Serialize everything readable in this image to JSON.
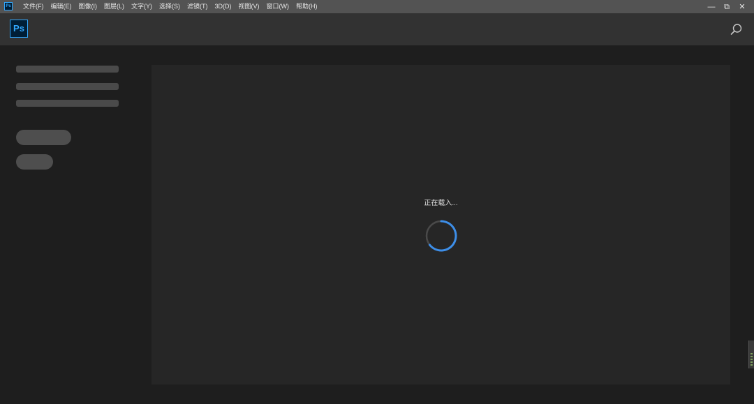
{
  "menubar": {
    "app_icon_label": "Ps",
    "items": [
      {
        "label": "文件(F)"
      },
      {
        "label": "编辑(E)"
      },
      {
        "label": "图像(I)"
      },
      {
        "label": "图层(L)"
      },
      {
        "label": "文字(Y)"
      },
      {
        "label": "选择(S)"
      },
      {
        "label": "滤镜(T)"
      },
      {
        "label": "3D(D)"
      },
      {
        "label": "视图(V)"
      },
      {
        "label": "窗口(W)"
      },
      {
        "label": "帮助(H)"
      }
    ],
    "window_controls": {
      "minimize": "—",
      "restore": "⧉",
      "close": "✕"
    }
  },
  "header": {
    "logo_text": "Ps",
    "search_icon": "search-icon"
  },
  "main": {
    "loading_text": "正在载入...",
    "spinner_color": "#3d8ee8",
    "spinner_track_color": "#4a4a4a"
  },
  "colors": {
    "menubar_bg": "#535353",
    "header_bg": "#323232",
    "body_bg": "#1e1e1e",
    "panel_bg": "#262626",
    "brand_accent": "#31a8ff"
  }
}
